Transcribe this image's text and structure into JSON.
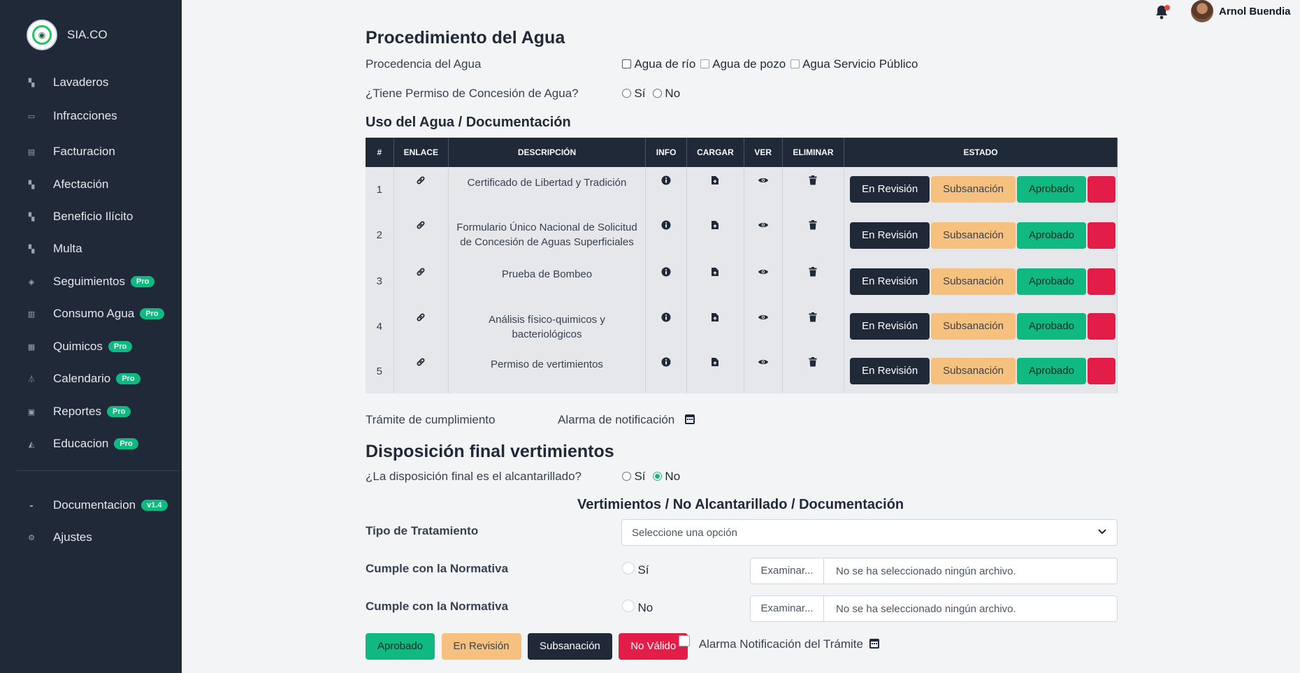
{
  "brand": {
    "name": "SIA.CO"
  },
  "sidebar": {
    "items": [
      {
        "label": "Lavaderos",
        "icon": "building-icon",
        "badge": ""
      },
      {
        "label": "Infracciones",
        "icon": "credit-card-icon",
        "badge": ""
      },
      {
        "label": "Facturacion",
        "icon": "receipt-icon",
        "badge": ""
      },
      {
        "label": "Afectación",
        "icon": "building-icon",
        "badge": ""
      },
      {
        "label": "Beneficio Ilícito",
        "icon": "building-icon",
        "badge": ""
      },
      {
        "label": "Multa",
        "icon": "building-icon",
        "badge": ""
      },
      {
        "label": "Seguimientos",
        "icon": "layers-icon",
        "badge": "Pro"
      },
      {
        "label": "Consumo Agua",
        "icon": "map-icon",
        "badge": "Pro"
      },
      {
        "label": "Quimicos",
        "icon": "calendar-icon",
        "badge": "Pro"
      },
      {
        "label": "Calendario",
        "icon": "flask-icon",
        "badge": "Pro"
      },
      {
        "label": "Reportes",
        "icon": "chart-icon",
        "badge": "Pro"
      },
      {
        "label": "Educacion",
        "icon": "graduation-cap-icon",
        "badge": "Pro"
      }
    ],
    "bottom": [
      {
        "label": "Documentacion",
        "icon": "inbox-icon",
        "badge": "v1.4"
      },
      {
        "label": "Ajustes",
        "icon": "gear-icon",
        "badge": ""
      }
    ]
  },
  "topbar": {
    "user_name": "Arnol Buendia"
  },
  "water": {
    "title": "Procedimiento del Agua",
    "origin_label": "Procedencia del Agua",
    "origin_options": [
      "Agua de río",
      "Agua de pozo",
      "Agua Servicio Público"
    ],
    "permit_label": "¿Tiene Permiso de Concesión de Agua?",
    "yes": "Sí",
    "no": "No"
  },
  "docs": {
    "title": "Uso del Agua / Documentación",
    "columns": [
      "#",
      "ENLACE",
      "DESCRIPCIÓN",
      "INFO",
      "CARGAR",
      "VER",
      "ELIMINAR",
      "ESTADO"
    ],
    "rows": [
      {
        "num": "1",
        "desc": "Certificado de Libertad y Tradición"
      },
      {
        "num": "2",
        "desc": "Formulario Único Nacional de Solicitud de Concesión de Aguas Superficiales"
      },
      {
        "num": "3",
        "desc": "Prueba de Bombeo"
      },
      {
        "num": "4",
        "desc": "Análisis físico-quimicos y bacteriológicos"
      },
      {
        "num": "5",
        "desc": "Permiso de vertimientos"
      }
    ],
    "status_buttons": [
      "En Revisión",
      "Subsanación",
      "Aprobado"
    ]
  },
  "tramite": {
    "label": "Trámite de cumplimiento",
    "alarm_label": "Alarma de notificación"
  },
  "disposal": {
    "title": "Disposición final vertimientos",
    "question": "¿La disposición final es el alcantarillado?",
    "yes": "Sí",
    "no": "No",
    "selected": "No"
  },
  "vertimientos": {
    "title": "Vertimientos / No Alcantarillado / Documentación",
    "treatment_label": "Tipo de Tratamiento",
    "treatment_placeholder": "Seleccione una opción",
    "norm_label": "Cumple con la Normativa",
    "yes": "Sí",
    "no": "No",
    "file_button": "Examinar...",
    "file_text": "No se ha seleccionado ningún archivo."
  },
  "footer_actions": {
    "approved": "Aprobado",
    "in_review": "En Revisión",
    "correction": "Subsanación",
    "invalid": "No Válido",
    "alarm_label": "Alarma Notificación del Trámite"
  },
  "colors": {
    "sidebar": "#1f2937",
    "accent_green": "#10b981",
    "amber": "#f6c17f",
    "red": "#e11d48"
  }
}
